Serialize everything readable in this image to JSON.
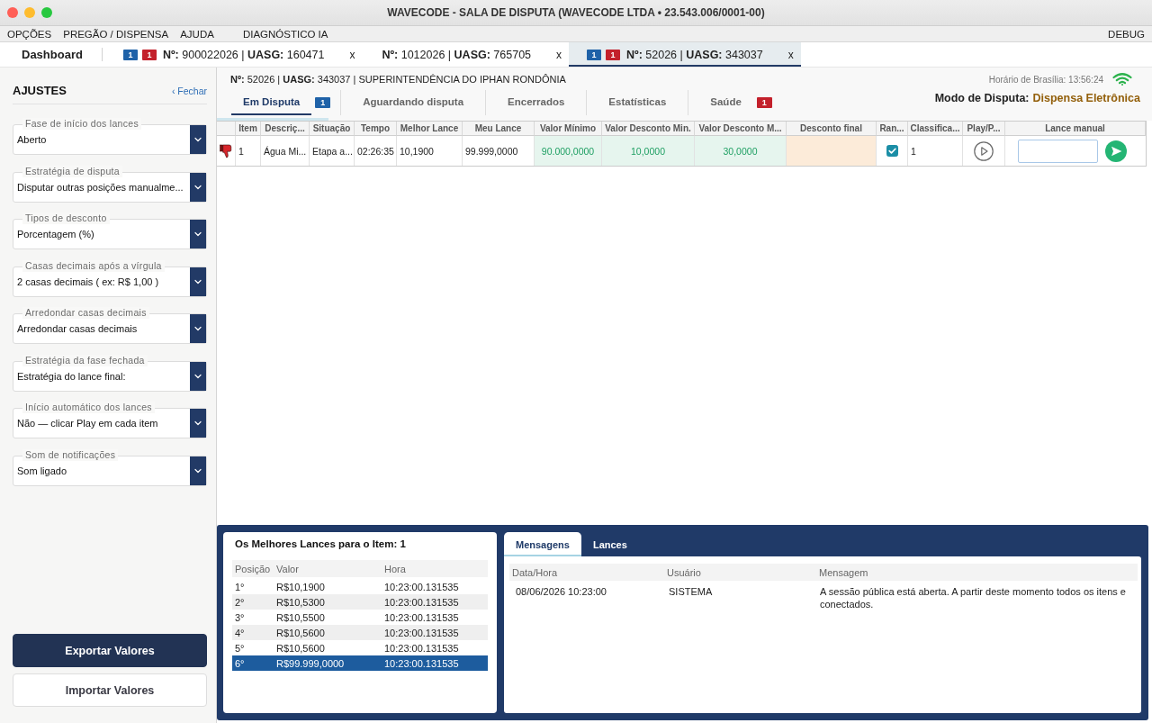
{
  "window": {
    "title": "WAVECODE - SALA DE DISPUTA (WAVECODE LTDA • 23.543.006/0001-00)"
  },
  "menu": {
    "left": [
      "OPÇÕES",
      "PREGÃO / DISPENSA",
      "AJUDA"
    ],
    "tools": [
      "DIAGNÓSTICO IA"
    ],
    "right": [
      "DEBUG"
    ]
  },
  "tabs": [
    {
      "kind": "home",
      "label": "Dashboard",
      "selected": false
    },
    {
      "kind": "process",
      "label": "**Nº:** 900022026 | **UASG:** 160471",
      "badges": [
        {
          "text": "1",
          "color": "#1f62a8"
        },
        {
          "text": "1",
          "color": "#c3202b"
        }
      ],
      "close": "x",
      "selected": false
    },
    {
      "kind": "process",
      "label": "**Nº:** 1012026 | **UASG:** 765705",
      "close": "x",
      "selected": false
    },
    {
      "kind": "process",
      "label": "**Nº:** 52026 | **UASG:** 343037",
      "badges": [
        {
          "text": "1",
          "color": "#1f62a8"
        },
        {
          "text": "1",
          "color": "#c3202b"
        }
      ],
      "close": "x",
      "selected": true
    }
  ],
  "sidebar": {
    "title": "AJUSTES",
    "close_link": "‹ Fechar",
    "settings": [
      {
        "label": "Fase de início dos lances",
        "value": "Aberto"
      },
      {
        "label": "Estratégia de disputa",
        "value": "Disputar outras posições manualme..."
      },
      {
        "label": "Tipos de desconto",
        "value": "Porcentagem (%)"
      },
      {
        "label": "Casas decimais após a vírgula",
        "value": "2 casas decimais ( ex: R$ 1,00 )"
      },
      {
        "label": "Arredondar casas decimais",
        "value": "Arredondar casas decimais"
      },
      {
        "label": "Estratégia da fase fechada",
        "value": "Estratégia do lance final:"
      },
      {
        "label": "Início automático dos lances",
        "value": "Não — clicar Play em cada item"
      },
      {
        "label": "Som de notificações",
        "value": "Som ligado"
      }
    ],
    "buttons": [
      {
        "label": "Exportar Valores",
        "kind": "primary"
      },
      {
        "label": "Importar Valores",
        "kind": "secondary"
      }
    ]
  },
  "header": {
    "process_info": "**Nº:** 52026 | **UASG:** 343037 | SUPERINTENDÊNCIA DO IPHAN RONDÔNIA",
    "clock": "Horário de Brasília: 13:56:24",
    "mode_label": "Modo de Disputa:",
    "mode_value": "Dispensa Eletrônica"
  },
  "status_tabs": [
    {
      "label": "Em Disputa",
      "selected": true,
      "badge": {
        "text": "1",
        "color": "#1f62a8"
      }
    },
    {
      "label": "Aguardando disputa",
      "selected": false
    },
    {
      "label": "Encerrados",
      "selected": false
    },
    {
      "label": "Estatísticas",
      "selected": false
    },
    {
      "label": "Saúde",
      "selected": false,
      "badge": {
        "text": "1",
        "color": "#c3202b"
      }
    }
  ],
  "table": {
    "columns": [
      "Item",
      "Descriç...",
      "Situação",
      "Tempo",
      "Melhor Lance",
      "Meu Lance",
      "Valor Mínimo",
      "Valor Desconto Min.",
      "Valor Desconto M...",
      "Desconto final",
      "Ran...",
      "Classifica...",
      "Play/P...",
      "Lance manual"
    ],
    "rows": [
      {
        "thumbs_down": true,
        "item": "1",
        "description": "Água Mi...",
        "situation": "Etapa a...",
        "time": "02:26:35",
        "best_bid": "10,1900",
        "my_bid": "99.999,0000",
        "min_value": "90.000,0000",
        "discount_value_min": "10,0000",
        "discount_value_m": "30,0000",
        "ranking_checked": true,
        "classification": "1"
      }
    ]
  },
  "best_bids": {
    "title": "Os Melhores Lances para o Item: 1",
    "columns": [
      "Posição",
      "Valor",
      "Hora"
    ],
    "rows": [
      {
        "position": "1°",
        "value": "R$10,1900",
        "time": "10:23:00.131535",
        "selected": false
      },
      {
        "position": "2°",
        "value": "R$10,5300",
        "time": "10:23:00.131535",
        "selected": false
      },
      {
        "position": "3°",
        "value": "R$10,5500",
        "time": "10:23:00.131535",
        "selected": false
      },
      {
        "position": "4°",
        "value": "R$10,5600",
        "time": "10:23:00.131535",
        "selected": false
      },
      {
        "position": "5°",
        "value": "R$10,5600",
        "time": "10:23:00.131535",
        "selected": false
      },
      {
        "position": "6°",
        "value": "R$99.999,0000",
        "time": "10:23:00.131535",
        "selected": true
      }
    ]
  },
  "messages": {
    "tabs": [
      {
        "label": "Mensagens",
        "selected": true
      },
      {
        "label": "Lances",
        "selected": false
      }
    ],
    "columns": [
      "Data/Hora",
      "Usuário",
      "Mensagem"
    ],
    "rows": [
      {
        "datetime": "08/06/2026 10:23:00",
        "user": "SISTEMA",
        "message": "A sessão pública está aberta. A partir deste momento todos os itens e conectados."
      }
    ]
  }
}
